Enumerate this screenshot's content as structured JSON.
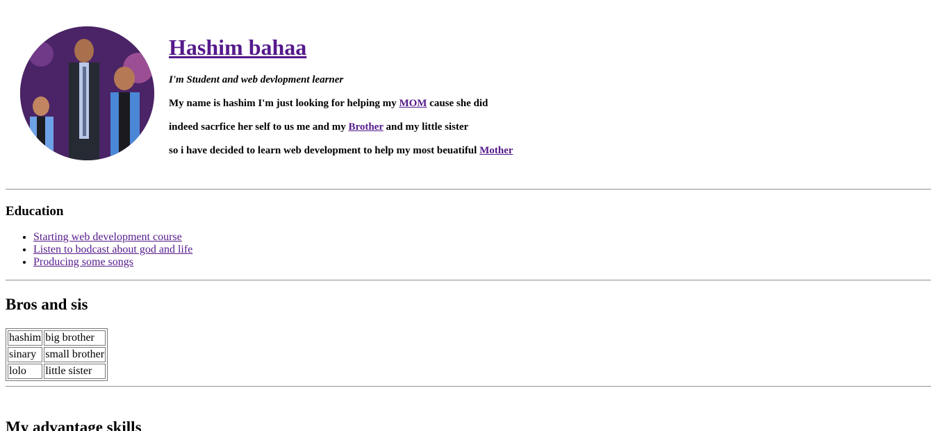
{
  "profile": {
    "name": "Hashim bahaa",
    "tagline": "I'm Student and web devlopment learner",
    "bio": {
      "line1_pre": "My name is hashim I'm just looking for helping my ",
      "line1_link": "MOM",
      "line1_post": " cause she did",
      "line2_pre": "indeed sacrfice her self to us me and my ",
      "line2_link": "Brother",
      "line2_post": " and my little sister",
      "line3_pre": "so i have decided to learn web development to help my most beuatiful ",
      "line3_link": "Mother"
    }
  },
  "education": {
    "heading": "Education",
    "items": [
      "Starting web development course",
      "Listen to bodcast about god and life",
      "Producing some songs"
    ]
  },
  "family": {
    "heading": "Bros and sis",
    "rows": [
      [
        "hashim",
        "big brother"
      ],
      [
        "sinary",
        "small brother"
      ],
      [
        "lolo",
        "little sister"
      ]
    ]
  },
  "skills": {
    "heading": "My advantage skills"
  },
  "colors": {
    "link": "#551a8b",
    "divider": "#9a9a9a"
  }
}
